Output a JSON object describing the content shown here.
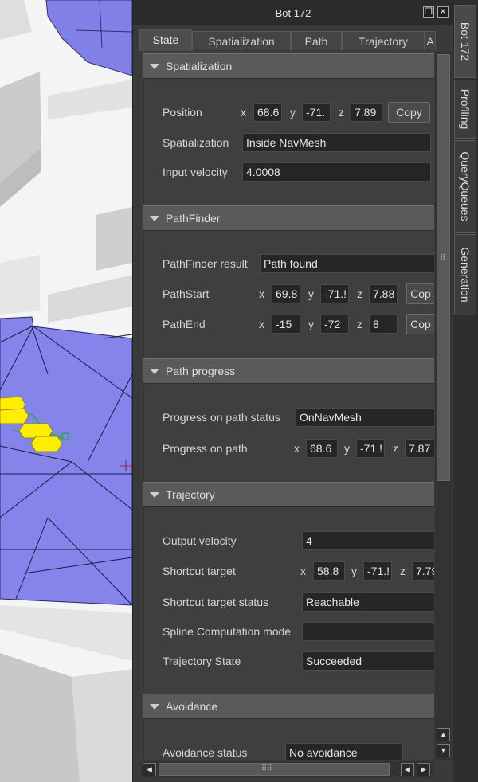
{
  "window": {
    "title": "Bot 172",
    "restore_glyph": "❐",
    "close_glyph": "✕"
  },
  "tabs": [
    {
      "label": "State",
      "active": true
    },
    {
      "label": "Spatialization"
    },
    {
      "label": "Path"
    },
    {
      "label": "Trajectory"
    },
    {
      "label": "A"
    }
  ],
  "side_tabs": [
    {
      "label": "Bot 172",
      "active": true
    },
    {
      "label": "Profiling"
    },
    {
      "label": "QueryQueues"
    },
    {
      "label": "Generation"
    }
  ],
  "spatialization": {
    "header": "Spatialization",
    "position_label": "Position",
    "x_label": "x",
    "x": "68.6",
    "y_label": "y",
    "y": "-71.",
    "z_label": "z",
    "z": "7.89",
    "copy": "Copy",
    "spatialization_label": "Spatialization",
    "spatialization_value": "Inside NavMesh",
    "input_velocity_label": "Input velocity",
    "input_velocity_value": "4.0008"
  },
  "pathfinder": {
    "header": "PathFinder",
    "result_label": "PathFinder result",
    "result_value": "Path found",
    "start_label": "PathStart",
    "start_x": "69.8",
    "start_y": "-71.!",
    "start_z": "7.88",
    "start_copy": "Cop",
    "end_label": "PathEnd",
    "end_x": "-15",
    "end_y": "-72",
    "end_z": "8",
    "end_copy": "Cop",
    "x_label": "x",
    "y_label": "y",
    "z_label": "z"
  },
  "path_progress": {
    "header": "Path progress",
    "status_label": "Progress on path status",
    "status_value": "OnNavMesh",
    "progress_label": "Progress on path",
    "x_label": "x",
    "x": "68.6",
    "y_label": "y",
    "y": "-71.!",
    "z_label": "z",
    "z": "7.87"
  },
  "trajectory": {
    "header": "Trajectory",
    "output_velocity_label": "Output velocity",
    "output_velocity_value": "4",
    "shortcut_target_label": "Shortcut target",
    "x_label": "x",
    "x": "58.8",
    "y_label": "y",
    "y": "-71.!",
    "z_label": "z",
    "z": "7.79",
    "shortcut_status_label": "Shortcut target status",
    "shortcut_status_value": "Reachable",
    "spline_mode_label": "Spline Computation mode",
    "spline_mode_value": "",
    "trajectory_state_label": "Trajectory State",
    "trajectory_state_value": "Succeeded"
  },
  "avoidance": {
    "header": "Avoidance",
    "status_label": "Avoidance status",
    "status_value": "No avoidance"
  },
  "scroll": {
    "up": "▲",
    "down": "▼",
    "left": "◀",
    "right": "▶",
    "grip_v": "⠿",
    "grip_h": "⠿⠿"
  },
  "colors": {
    "navmesh": "#8282e8",
    "bot": "#ffee00",
    "panel": "#3a3a3a",
    "header": "#5a5a5a",
    "field": "#262626"
  }
}
